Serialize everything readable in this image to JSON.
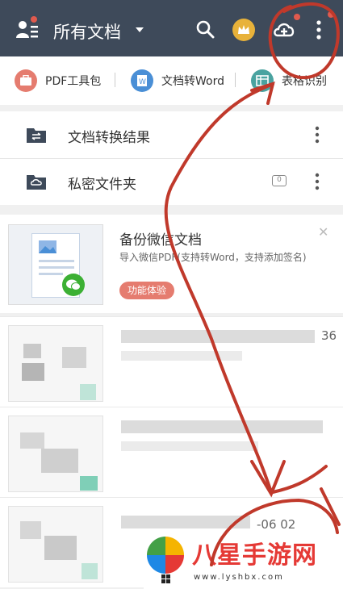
{
  "header": {
    "title": "所有文档"
  },
  "tools": [
    {
      "label": "PDF工具包",
      "icon": "toolbox-icon",
      "color": "#e57c6f"
    },
    {
      "label": "文档转Word",
      "icon": "word-icon",
      "color": "#4a8fd6"
    },
    {
      "label": "表格识别",
      "icon": "table-icon",
      "color": "#4aa3a0"
    }
  ],
  "folders": [
    {
      "label": "文档转换结果",
      "icon": "convert-folder-icon"
    },
    {
      "label": "私密文件夹",
      "icon": "private-folder-icon",
      "badge": "0"
    }
  ],
  "promo": {
    "title": "备份微信文档",
    "subtitle": "导入微信PDF(支持转Word，支持添加签名)",
    "tag": "功能体验"
  },
  "files": [
    {
      "meta": "36"
    },
    {
      "meta": ""
    },
    {
      "meta": "-06 02"
    }
  ],
  "watermark": {
    "name": "八星手游网",
    "url": "www.lyshbx.com"
  },
  "colors": {
    "topbar": "#3e4a5a",
    "annotation": "#c0392b",
    "accent": "#e57c6f"
  }
}
